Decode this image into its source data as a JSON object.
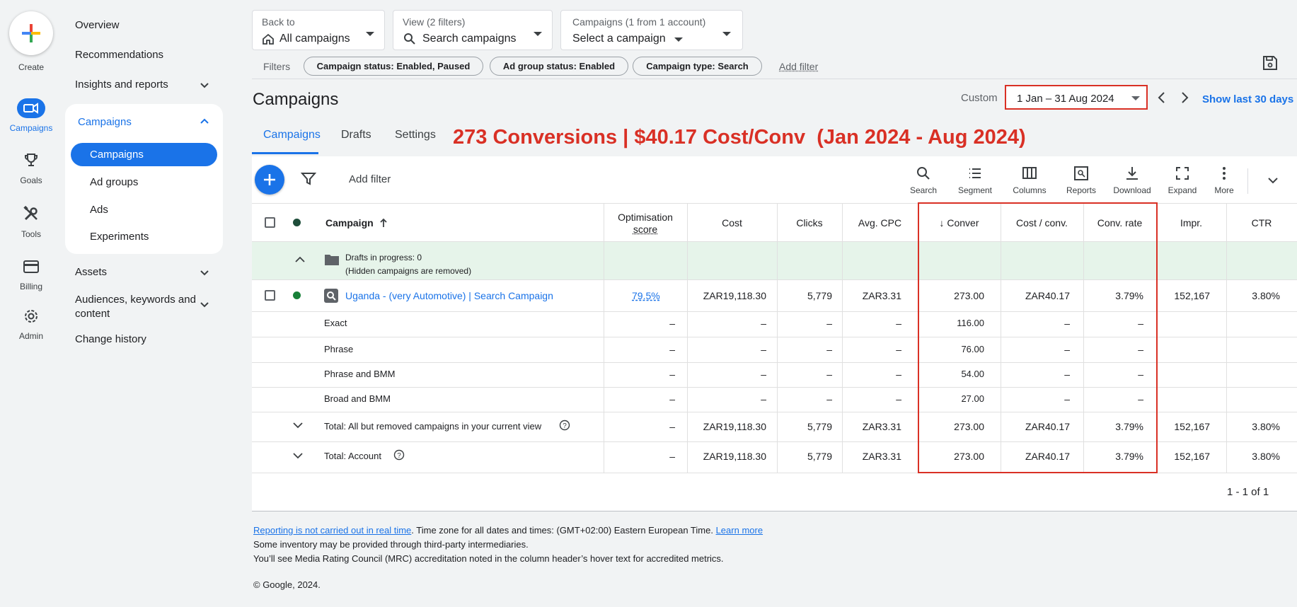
{
  "rail": {
    "create": "Create",
    "items": [
      {
        "label": "Campaigns",
        "icon": "campaigns-icon",
        "active": true
      },
      {
        "label": "Goals",
        "icon": "trophy-icon"
      },
      {
        "label": "Tools",
        "icon": "tools-icon"
      },
      {
        "label": "Billing",
        "icon": "credit-card-icon"
      },
      {
        "label": "Admin",
        "icon": "gear-icon"
      }
    ]
  },
  "nav": {
    "overview": "Overview",
    "recommendations": "Recommendations",
    "insights": "Insights and reports",
    "campaigns_group": "Campaigns",
    "sub": [
      "Campaigns",
      "Ad groups",
      "Ads",
      "Experiments"
    ],
    "assets": "Assets",
    "audiences_line1": "Audiences, keywords and",
    "audiences_line2": "content",
    "change_history": "Change history"
  },
  "topbar": {
    "back_small": "Back to",
    "back_big": "All campaigns",
    "view_small": "View (2 filters)",
    "view_big": "Search campaigns",
    "camp_small": "Campaigns (1 from 1 account)",
    "camp_big": "Select a campaign"
  },
  "filters": {
    "label": "Filters",
    "chips": [
      "Campaign status: Enabled, Paused",
      "Ad group status: Enabled",
      "Campaign type: Search"
    ],
    "add": "Add filter"
  },
  "page": {
    "title": "Campaigns",
    "custom": "Custom",
    "date_range": "1 Jan – 31 Aug 2024",
    "show_last": "Show last 30 days",
    "tabs": [
      "Campaigns",
      "Drafts",
      "Settings"
    ],
    "annotation": "273 Conversions | $40.17 Cost/Conv  (Jan 2024 - Aug 2024)"
  },
  "toolbar": {
    "add_filter": "Add filter",
    "tools": [
      "Search",
      "Segment",
      "Columns",
      "Reports",
      "Download",
      "Expand",
      "More"
    ]
  },
  "table": {
    "headers": {
      "campaign": "Campaign",
      "opt1": "Optimisation",
      "opt2": "score",
      "cost": "Cost",
      "clicks": "Clicks",
      "avg_cpc": "Avg. CPC",
      "conv": "Conver",
      "cost_conv": "Cost / conv.",
      "conv_rate": "Conv. rate",
      "impr": "Impr.",
      "ctr": "CTR"
    },
    "drafts_line1": "Drafts in progress: 0",
    "drafts_line2": "(Hidden campaigns are removed)",
    "campaign_row": {
      "name": "Uganda - (very Automotive) | Search Campaign",
      "opt": "79.5%",
      "cost": "ZAR19,118.30",
      "clicks": "5,779",
      "avg_cpc": "ZAR3.31",
      "conv": "273.00",
      "cost_conv": "ZAR40.17",
      "conv_rate": "3.79%",
      "impr": "152,167",
      "ctr": "3.80%"
    },
    "segment_rows": [
      {
        "name": "Exact",
        "conv": "116.00"
      },
      {
        "name": "Phrase",
        "conv": "76.00"
      },
      {
        "name": "Phrase and BMM",
        "conv": "54.00"
      },
      {
        "name": "Broad and BMM",
        "conv": "27.00"
      }
    ],
    "dash": "–",
    "total_rows": [
      {
        "name": "Total: All but removed campaigns in your current view",
        "opt": "–",
        "cost": "ZAR19,118.30",
        "clicks": "5,779",
        "avg_cpc": "ZAR3.31",
        "conv": "273.00",
        "cost_conv": "ZAR40.17",
        "conv_rate": "3.79%",
        "impr": "152,167",
        "ctr": "3.80%"
      },
      {
        "name": "Total: Account",
        "opt": "–",
        "cost": "ZAR19,118.30",
        "clicks": "5,779",
        "avg_cpc": "ZAR3.31",
        "conv": "273.00",
        "cost_conv": "ZAR40.17",
        "conv_rate": "3.79%",
        "impr": "152,167",
        "ctr": "3.80%"
      }
    ],
    "pagination": "1 - 1 of 1"
  },
  "footer": {
    "link1": "Reporting is not carried out in real time",
    "text1": ". Time zone for all dates and times: (GMT+02:00) Eastern European Time. ",
    "link2": "Learn more",
    "line2": "Some inventory may be provided through third-party intermediaries.",
    "line3": "You’ll see Media Rating Council (MRC) accreditation noted in the column header’s hover text for accredited metrics.",
    "copyright": "© Google, 2024."
  },
  "colors": {
    "accent": "#1a73e8",
    "highlight_red": "#d93025",
    "drafts_row_bg": "#e6f4ea",
    "status_green": "#188038"
  }
}
